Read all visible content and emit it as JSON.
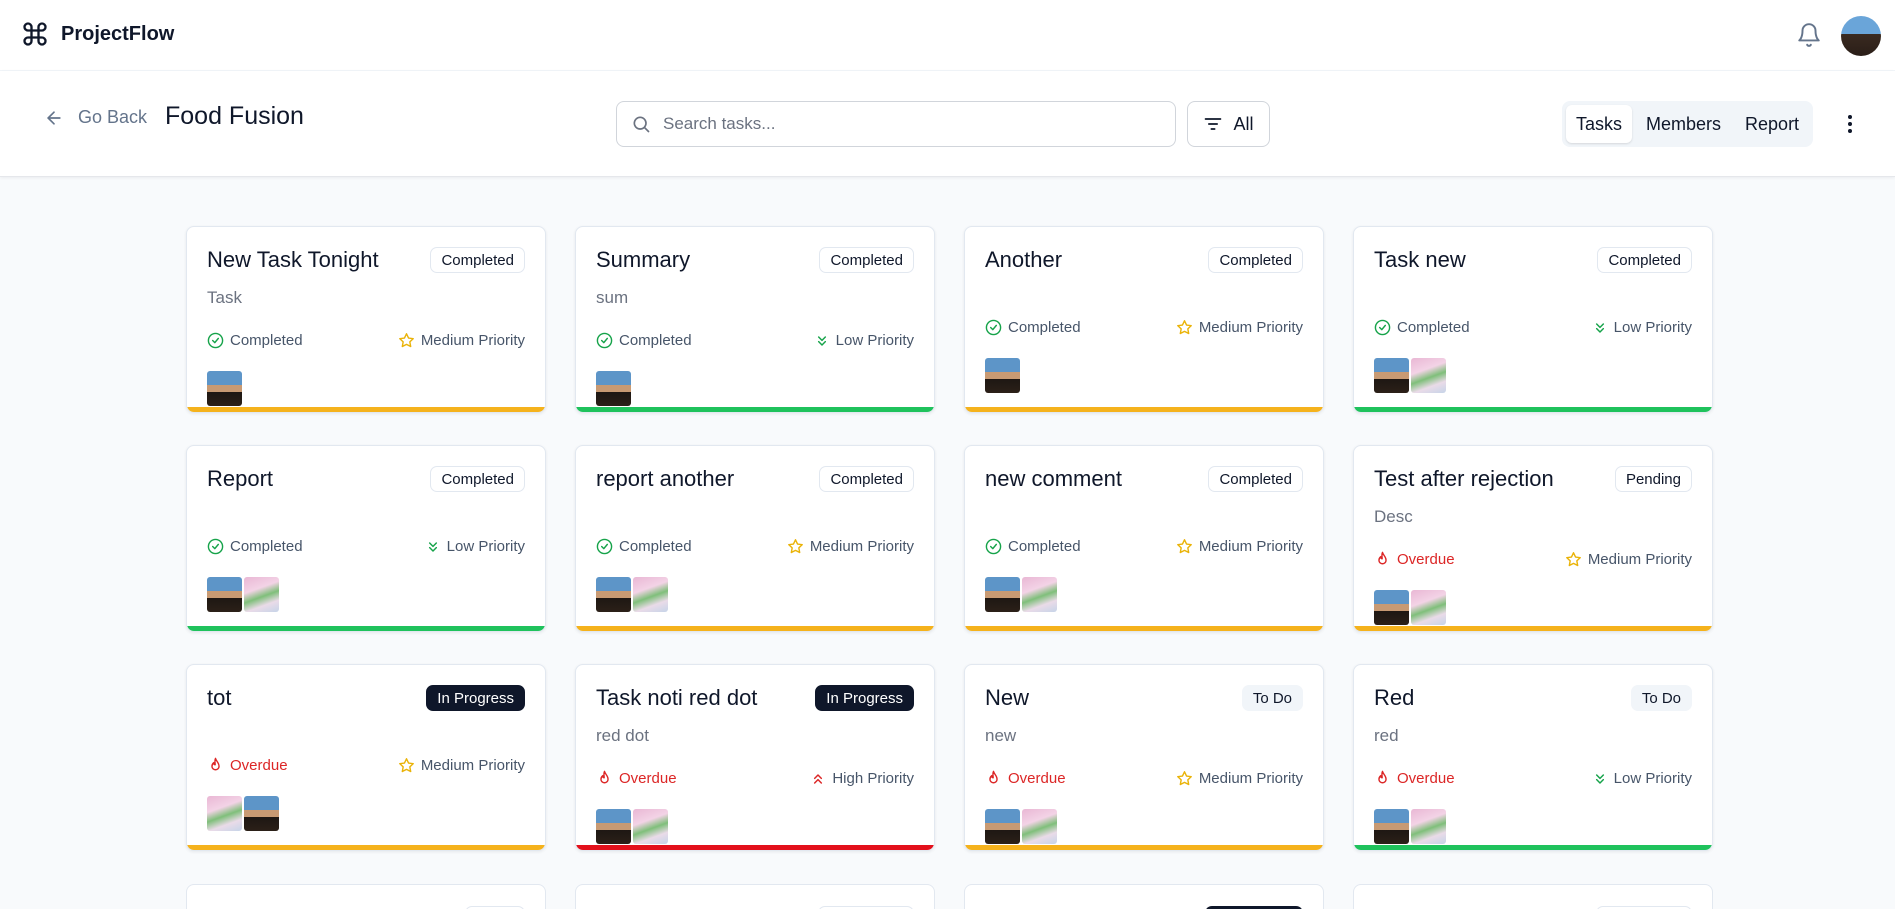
{
  "app": {
    "name": "ProjectFlow"
  },
  "header": {
    "back_label": "Go Back",
    "project_title": "Food Fusion",
    "search_placeholder": "Search tasks...",
    "filter_label": "All",
    "tabs": [
      {
        "label": "Tasks",
        "active": true
      },
      {
        "label": "Members",
        "active": false
      },
      {
        "label": "Report",
        "active": false
      }
    ]
  },
  "colors": {
    "medium": "#f5b21c",
    "low": "#1fc25c",
    "high": "#e3101b",
    "overdue": "#dc2626"
  },
  "tasks": [
    {
      "title": "New Task Tonight",
      "description": "Task",
      "badge": "Completed",
      "status": "Completed",
      "priority": "Medium Priority"
    },
    {
      "title": "Summary",
      "description": "sum",
      "badge": "Completed",
      "status": "Completed",
      "priority": "Low Priority"
    },
    {
      "title": "Another",
      "description": "",
      "badge": "Completed",
      "status": "Completed",
      "priority": "Medium Priority"
    },
    {
      "title": "Task new",
      "description": "",
      "badge": "Completed",
      "status": "Completed",
      "priority": "Low Priority"
    },
    {
      "title": "Report",
      "description": "",
      "badge": "Completed",
      "status": "Completed",
      "priority": "Low Priority"
    },
    {
      "title": "report another",
      "description": "",
      "badge": "Completed",
      "status": "Completed",
      "priority": "Medium Priority"
    },
    {
      "title": "new comment",
      "description": "",
      "badge": "Completed",
      "status": "Completed",
      "priority": "Medium Priority"
    },
    {
      "title": "Test after rejection",
      "description": "Desc",
      "badge": "Pending",
      "status": "Overdue",
      "priority": "Medium Priority"
    },
    {
      "title": "tot",
      "description": "",
      "badge": "In Progress",
      "status": "Overdue",
      "priority": "Medium Priority"
    },
    {
      "title": "Task noti red dot",
      "description": "red dot",
      "badge": "In Progress",
      "status": "Overdue",
      "priority": "High Priority"
    },
    {
      "title": "New",
      "description": "new",
      "badge": "To Do",
      "status": "Overdue",
      "priority": "Medium Priority"
    },
    {
      "title": "Red",
      "description": "red",
      "badge": "To Do",
      "status": "Overdue",
      "priority": "Low Priority"
    }
  ]
}
